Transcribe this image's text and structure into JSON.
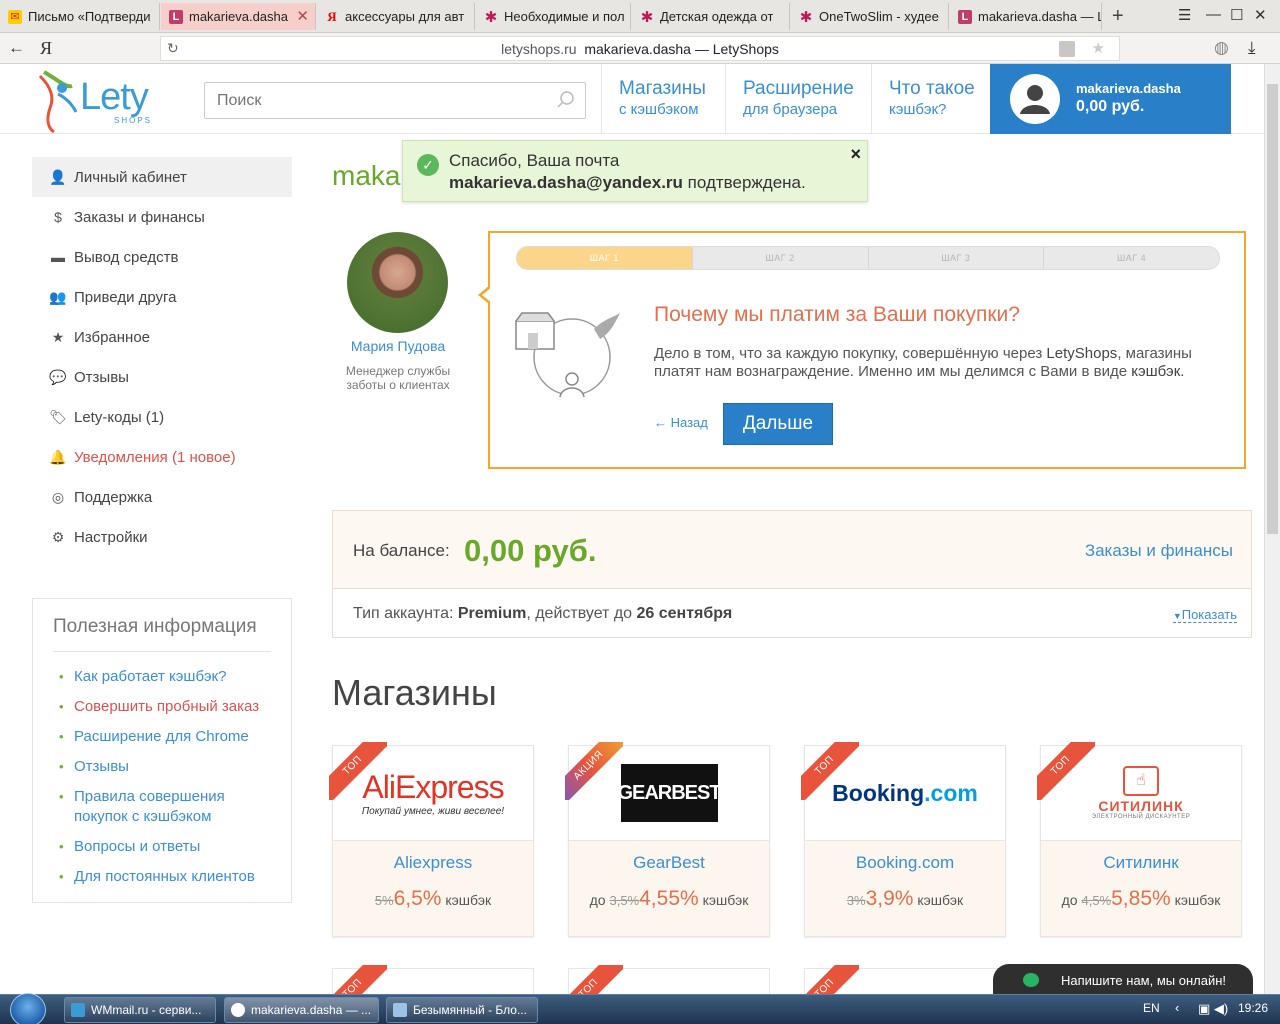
{
  "browser": {
    "tabs": [
      {
        "icon": "mail-icon",
        "label": "Письмо «Подтверди"
      },
      {
        "icon": "lety-icon",
        "label": "makarieva.dasha"
      },
      {
        "icon": "yandex-icon",
        "label": "аксессуары для авт"
      },
      {
        "icon": "flower-icon",
        "label": "Необходимые и пол"
      },
      {
        "icon": "flower-icon",
        "label": "Детская одежда от"
      },
      {
        "icon": "flower-icon",
        "label": "OneTwoSlim - худее"
      },
      {
        "icon": "lety-icon",
        "label": "makarieva.dasha — L"
      }
    ],
    "url_domain": "letyshops.ru",
    "url_title": "makarieva.dasha — LetyShops"
  },
  "header": {
    "logo_text": "Lety",
    "logo_sub": "SHOPS",
    "search_placeholder": "Поиск",
    "nav": [
      {
        "l1": "Магазины",
        "l2": "с кэшбэком"
      },
      {
        "l1": "Расширение",
        "l2": "для браузера"
      },
      {
        "l1": "Что такое",
        "l2": "кэшбэк?"
      }
    ],
    "username": "makarieva.dasha",
    "balance": "0,00 руб."
  },
  "toast": {
    "line1": "Спасибо, Ваша почта",
    "email": "makarieva.dasha@yandex.ru",
    "line2_suffix": " подтверждена."
  },
  "page_title": "makarieva.dasha",
  "sidebar": {
    "items": [
      {
        "icon": "user-icon",
        "label": "Личный кабинет"
      },
      {
        "icon": "dollar-icon",
        "label": "Заказы и финансы"
      },
      {
        "icon": "card-icon",
        "label": "Вывод средств"
      },
      {
        "icon": "add-user-icon",
        "label": "Приведи друга"
      },
      {
        "icon": "star-icon",
        "label": "Избранное"
      },
      {
        "icon": "comments-icon",
        "label": "Отзывы"
      },
      {
        "icon": "tag-icon",
        "label": "Lety-коды (1)"
      },
      {
        "icon": "bell-icon",
        "label": "Уведомления (1 новое)"
      },
      {
        "icon": "lifebuoy-icon",
        "label": "Поддержка"
      },
      {
        "icon": "gear-icon",
        "label": "Настройки"
      }
    ],
    "info_title": "Полезная информация",
    "info_links": [
      "Как работает кэшбэк?",
      "Совершить пробный заказ",
      "Расширение для Chrome",
      "Отзывы",
      "Правила совершения покупок с кэшбэком",
      "Вопросы и ответы",
      "Для постоянных клиентов"
    ]
  },
  "manager": {
    "name": "Мария Пудова",
    "role": "Менеджер службы заботы о клиентах"
  },
  "onboarding": {
    "steps": [
      "ШАГ 1",
      "ШАГ 2",
      "ШАГ 3",
      "ШАГ 4"
    ],
    "active_step": 1,
    "title": "Почему мы платим за Ваши покупки?",
    "text_a": "Дело в том, что за каждую покупку, совершённую через ",
    "text_brand": "LetyShops",
    "text_b": ", магазины платят нам вознаграждение. Именно им мы делимся с Вами в виде ",
    "text_cashback": "кэшбэк.",
    "back": "← Назад",
    "next": "Дальше"
  },
  "balance": {
    "label": "На балансе:",
    "value": "0,00 руб.",
    "link": "Заказы и финансы",
    "acc_prefix": "Тип аккаунта: ",
    "acc_type": "Premium",
    "acc_mid": ", действует до ",
    "acc_until": "26 сентября",
    "show": "Показать"
  },
  "stores_title": "Магазины",
  "stores": [
    {
      "ribbon": "ТОП",
      "name": "Aliexpress",
      "prefix": "",
      "old": "5%",
      "new": "6,5%",
      "suffix": "кэшбэк",
      "logo_a": "AliExpress",
      "logo_b": "Покупай умнее, живи веселее!"
    },
    {
      "ribbon": "АКЦИЯ",
      "name": "GearBest",
      "prefix": "до ",
      "old": "3,5%",
      "new": "4,55%",
      "suffix": "кэшбэк",
      "logo_a": "GEARBEST",
      "logo_b": ""
    },
    {
      "ribbon": "ТОП",
      "name": "Booking.com",
      "prefix": "",
      "old": "3%",
      "new": "3,9%",
      "suffix": "кэшбэк",
      "logo_a": "Booking",
      "logo_b": ".com"
    },
    {
      "ribbon": "ТОП",
      "name": "Ситилинк",
      "prefix": "до ",
      "old": "4,5%",
      "new": "5,85%",
      "suffix": "кэшбэк",
      "logo_a": "СИТИЛИНК",
      "logo_b": "ЭЛЕКТРОННЫЙ ДИСКАУНТЕР"
    }
  ],
  "second_row_ribbons": [
    "ТОП",
    "ТОП",
    "ТОП"
  ],
  "chat": "Напишите нам, мы онлайн!",
  "taskbar": {
    "items": [
      "WMmail.ru - серви...",
      "makarieva.dasha — ...",
      "Безымянный - Бло..."
    ],
    "lang": "EN",
    "time": "19:26"
  },
  "colors": {
    "accent": "#2a80c8",
    "link": "#3b8fd0",
    "green": "#6aa829",
    "orange": "#e2704c",
    "ribbon": "#e8533c"
  }
}
